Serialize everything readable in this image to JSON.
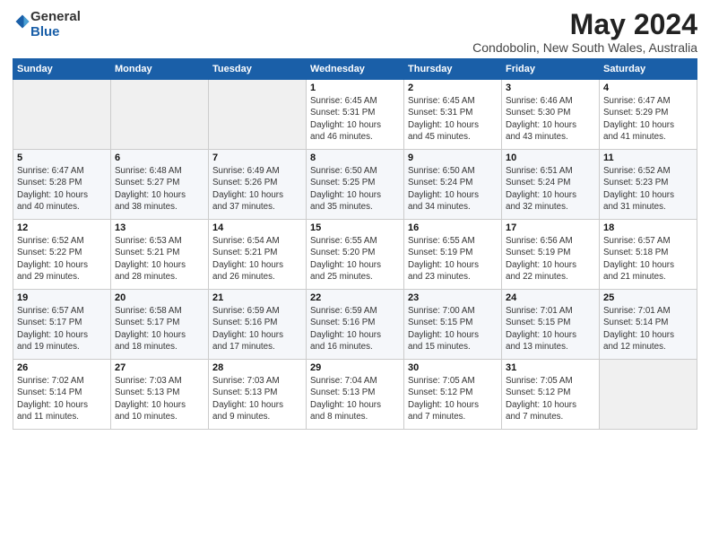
{
  "logo": {
    "general": "General",
    "blue": "Blue"
  },
  "title": "May 2024",
  "subtitle": "Condobolin, New South Wales, Australia",
  "days_header": [
    "Sunday",
    "Monday",
    "Tuesday",
    "Wednesday",
    "Thursday",
    "Friday",
    "Saturday"
  ],
  "weeks": [
    [
      {
        "num": "",
        "info": ""
      },
      {
        "num": "",
        "info": ""
      },
      {
        "num": "",
        "info": ""
      },
      {
        "num": "1",
        "info": "Sunrise: 6:45 AM\nSunset: 5:31 PM\nDaylight: 10 hours\nand 46 minutes."
      },
      {
        "num": "2",
        "info": "Sunrise: 6:45 AM\nSunset: 5:31 PM\nDaylight: 10 hours\nand 45 minutes."
      },
      {
        "num": "3",
        "info": "Sunrise: 6:46 AM\nSunset: 5:30 PM\nDaylight: 10 hours\nand 43 minutes."
      },
      {
        "num": "4",
        "info": "Sunrise: 6:47 AM\nSunset: 5:29 PM\nDaylight: 10 hours\nand 41 minutes."
      }
    ],
    [
      {
        "num": "5",
        "info": "Sunrise: 6:47 AM\nSunset: 5:28 PM\nDaylight: 10 hours\nand 40 minutes."
      },
      {
        "num": "6",
        "info": "Sunrise: 6:48 AM\nSunset: 5:27 PM\nDaylight: 10 hours\nand 38 minutes."
      },
      {
        "num": "7",
        "info": "Sunrise: 6:49 AM\nSunset: 5:26 PM\nDaylight: 10 hours\nand 37 minutes."
      },
      {
        "num": "8",
        "info": "Sunrise: 6:50 AM\nSunset: 5:25 PM\nDaylight: 10 hours\nand 35 minutes."
      },
      {
        "num": "9",
        "info": "Sunrise: 6:50 AM\nSunset: 5:24 PM\nDaylight: 10 hours\nand 34 minutes."
      },
      {
        "num": "10",
        "info": "Sunrise: 6:51 AM\nSunset: 5:24 PM\nDaylight: 10 hours\nand 32 minutes."
      },
      {
        "num": "11",
        "info": "Sunrise: 6:52 AM\nSunset: 5:23 PM\nDaylight: 10 hours\nand 31 minutes."
      }
    ],
    [
      {
        "num": "12",
        "info": "Sunrise: 6:52 AM\nSunset: 5:22 PM\nDaylight: 10 hours\nand 29 minutes."
      },
      {
        "num": "13",
        "info": "Sunrise: 6:53 AM\nSunset: 5:21 PM\nDaylight: 10 hours\nand 28 minutes."
      },
      {
        "num": "14",
        "info": "Sunrise: 6:54 AM\nSunset: 5:21 PM\nDaylight: 10 hours\nand 26 minutes."
      },
      {
        "num": "15",
        "info": "Sunrise: 6:55 AM\nSunset: 5:20 PM\nDaylight: 10 hours\nand 25 minutes."
      },
      {
        "num": "16",
        "info": "Sunrise: 6:55 AM\nSunset: 5:19 PM\nDaylight: 10 hours\nand 23 minutes."
      },
      {
        "num": "17",
        "info": "Sunrise: 6:56 AM\nSunset: 5:19 PM\nDaylight: 10 hours\nand 22 minutes."
      },
      {
        "num": "18",
        "info": "Sunrise: 6:57 AM\nSunset: 5:18 PM\nDaylight: 10 hours\nand 21 minutes."
      }
    ],
    [
      {
        "num": "19",
        "info": "Sunrise: 6:57 AM\nSunset: 5:17 PM\nDaylight: 10 hours\nand 19 minutes."
      },
      {
        "num": "20",
        "info": "Sunrise: 6:58 AM\nSunset: 5:17 PM\nDaylight: 10 hours\nand 18 minutes."
      },
      {
        "num": "21",
        "info": "Sunrise: 6:59 AM\nSunset: 5:16 PM\nDaylight: 10 hours\nand 17 minutes."
      },
      {
        "num": "22",
        "info": "Sunrise: 6:59 AM\nSunset: 5:16 PM\nDaylight: 10 hours\nand 16 minutes."
      },
      {
        "num": "23",
        "info": "Sunrise: 7:00 AM\nSunset: 5:15 PM\nDaylight: 10 hours\nand 15 minutes."
      },
      {
        "num": "24",
        "info": "Sunrise: 7:01 AM\nSunset: 5:15 PM\nDaylight: 10 hours\nand 13 minutes."
      },
      {
        "num": "25",
        "info": "Sunrise: 7:01 AM\nSunset: 5:14 PM\nDaylight: 10 hours\nand 12 minutes."
      }
    ],
    [
      {
        "num": "26",
        "info": "Sunrise: 7:02 AM\nSunset: 5:14 PM\nDaylight: 10 hours\nand 11 minutes."
      },
      {
        "num": "27",
        "info": "Sunrise: 7:03 AM\nSunset: 5:13 PM\nDaylight: 10 hours\nand 10 minutes."
      },
      {
        "num": "28",
        "info": "Sunrise: 7:03 AM\nSunset: 5:13 PM\nDaylight: 10 hours\nand 9 minutes."
      },
      {
        "num": "29",
        "info": "Sunrise: 7:04 AM\nSunset: 5:13 PM\nDaylight: 10 hours\nand 8 minutes."
      },
      {
        "num": "30",
        "info": "Sunrise: 7:05 AM\nSunset: 5:12 PM\nDaylight: 10 hours\nand 7 minutes."
      },
      {
        "num": "31",
        "info": "Sunrise: 7:05 AM\nSunset: 5:12 PM\nDaylight: 10 hours\nand 7 minutes."
      },
      {
        "num": "",
        "info": ""
      }
    ]
  ]
}
